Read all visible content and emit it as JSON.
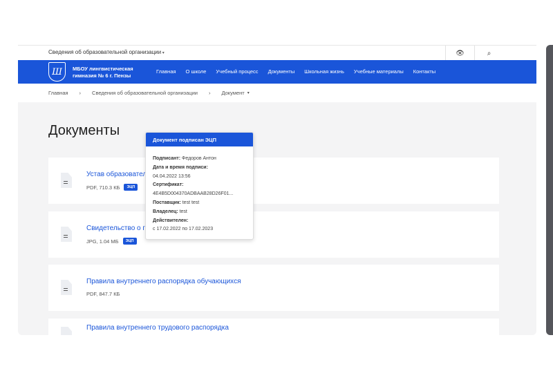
{
  "topbar": {
    "org_menu": "Сведения об образовательной организации"
  },
  "header": {
    "brand_line1": "МБОУ лингвистическая",
    "brand_line2": "гимназия № 6 г. Пензы",
    "logo_letter": "Ш",
    "menu": [
      "Главная",
      "О школе",
      "Учебный процесс",
      "Документы",
      "Школьная жизнь",
      "Учебные материалы",
      "Контакты"
    ]
  },
  "breadcrumb": [
    "Главная",
    "Сведения об образовательной организации",
    "Документ"
  ],
  "page_title": "Документы",
  "documents": [
    {
      "title": "Устав образовательного учреждения",
      "meta": "PDF, 710.3 КБ",
      "badge": "ЭЦП"
    },
    {
      "title": "Свидетельство о государственной аккредитации",
      "meta": "JPG, 1.04 МБ",
      "badge": "ЭЦП"
    },
    {
      "title": "Правила внутреннего распорядка обучающихся",
      "meta": "PDF, 847.7 КБ"
    },
    {
      "title": "Правила внутреннего трудового распорядка"
    }
  ],
  "tooltip": {
    "title": "Документ подписан ЭЦП",
    "signer_label": "Подписант:",
    "signer": "Федоров Антон",
    "date_label": "Дата и время подписи:",
    "date": "04.04.2022 13:56",
    "cert_label": "Сертификат:",
    "cert": "4E4B5D004370ADBAAB28D26F01...",
    "supplier_label": "Поставщик:",
    "supplier": "test test",
    "owner_label": "Владелец:",
    "owner": "test",
    "valid_label": "Действителен:",
    "valid": "с 17.02.2022 по 17.02.2023"
  }
}
